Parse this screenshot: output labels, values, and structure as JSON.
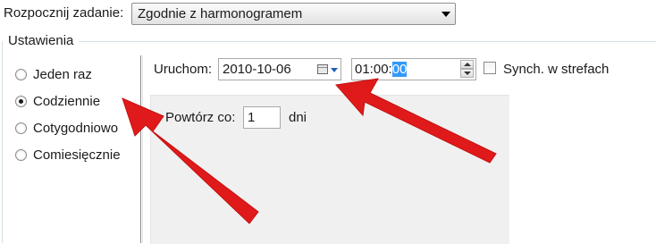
{
  "header": {
    "start_label": "Rozpocznij zadanie:",
    "start_value": "Zgodnie z harmonogramem"
  },
  "settings": {
    "group_title": "Ustawienia",
    "options": [
      "Jeden raz",
      "Codziennie",
      "Cotygodniowo",
      "Comiesięcznie"
    ],
    "selected": "Codziennie"
  },
  "schedule": {
    "start_label": "Uruchom:",
    "date_value": "2010-10-06",
    "time_prefix": "01:00:",
    "time_selected": "00",
    "sync_label": "Synch. w strefach",
    "sync_checked": false
  },
  "repeat": {
    "label": "Powtórz co:",
    "value": "1",
    "unit": "dni"
  },
  "colors": {
    "annotation_arrow": "#e01a1a",
    "selection": "#3399ff"
  }
}
